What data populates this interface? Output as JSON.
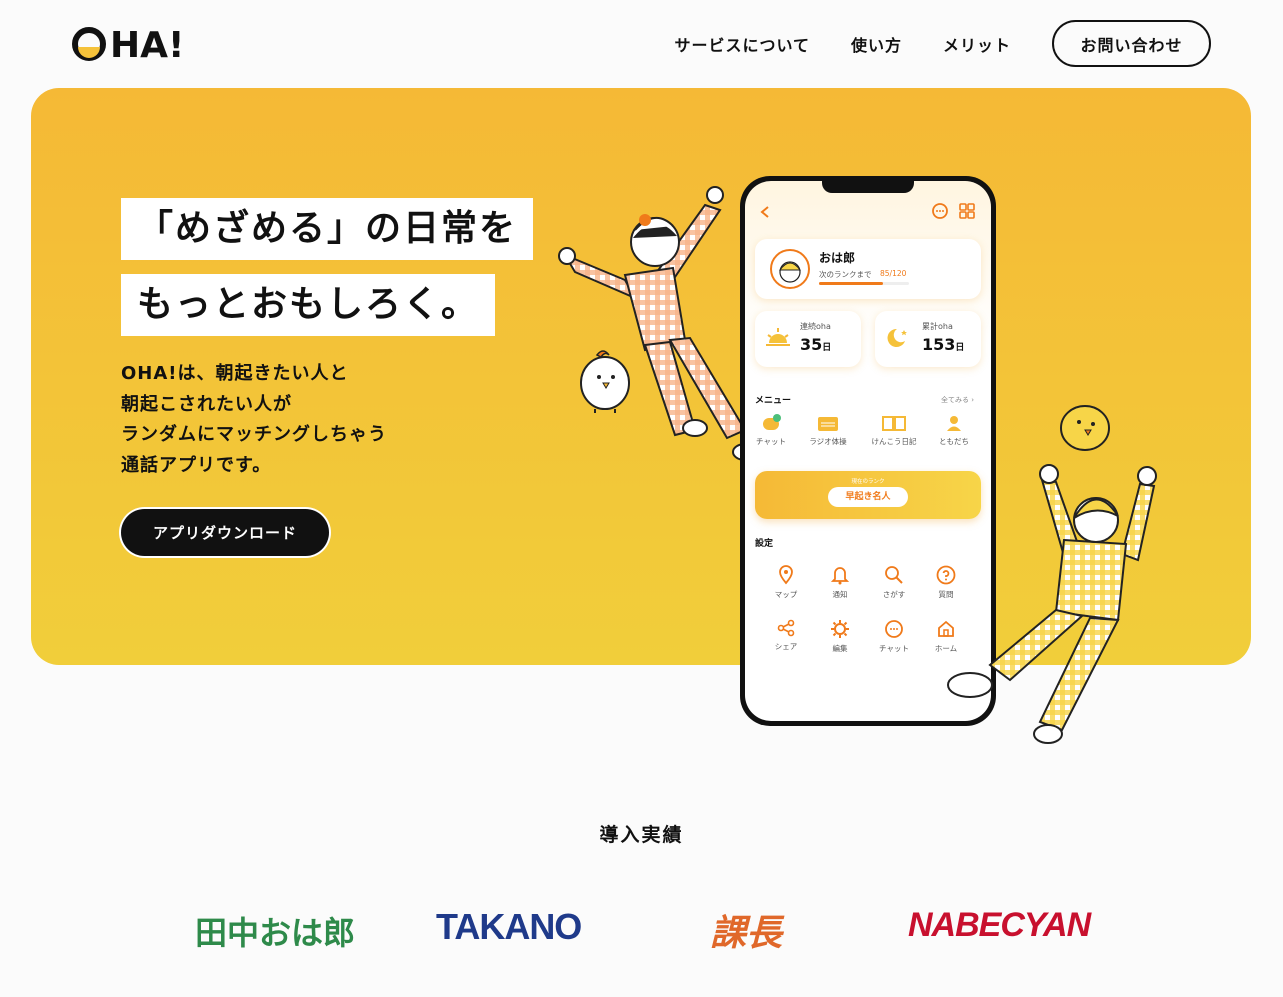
{
  "brand": {
    "logo_text": "OHA!"
  },
  "nav": {
    "items": [
      "サービスについて",
      "使い方",
      "メリット"
    ],
    "contact_label": "お問い合わせ"
  },
  "hero": {
    "headline_1": "「めざめる」の日常を",
    "headline_2": "もっとおもしろく。",
    "lead": [
      "OHA!は、朝起きたい人と",
      "朝起こされたい人が",
      "ランダムにマッチングしちゃう",
      "通話アプリです。"
    ],
    "download_label": "アプリダウンロード"
  },
  "app": {
    "user_name": "おは郎",
    "next_rank_label": "次のランクまで",
    "next_rank_value": "85/120",
    "rank_progress": 0.71,
    "streak_label": "連続oha",
    "streak_value": "35",
    "total_label": "累計oha",
    "total_value": "153",
    "day_unit": "日",
    "menu_title": "メニュー",
    "see_all": "全てみる ›",
    "menu": [
      "チャット",
      "ラジオ体操",
      "けんこう日記",
      "ともだち"
    ],
    "chat_badge": "4",
    "current_rank_label": "現在のランク",
    "current_rank": "早起き名人",
    "settings_title": "設定",
    "settings": [
      "マップ",
      "通知",
      "さがす",
      "質問",
      "シェア",
      "編集",
      "チャット",
      "ホーム"
    ]
  },
  "clients": {
    "title": "導入実績",
    "logos": [
      {
        "name": "田中おは郎",
        "color": "#2e8a4a"
      },
      {
        "name": "TAKANO",
        "color": "#1f3a8a"
      },
      {
        "name": "課長",
        "color": "#e0682a"
      },
      {
        "name": "NABECYAN",
        "color": "#c8102e"
      }
    ]
  },
  "colors": {
    "accent": "#f5b936",
    "dark": "#111111",
    "orange": "#f07a1a"
  }
}
